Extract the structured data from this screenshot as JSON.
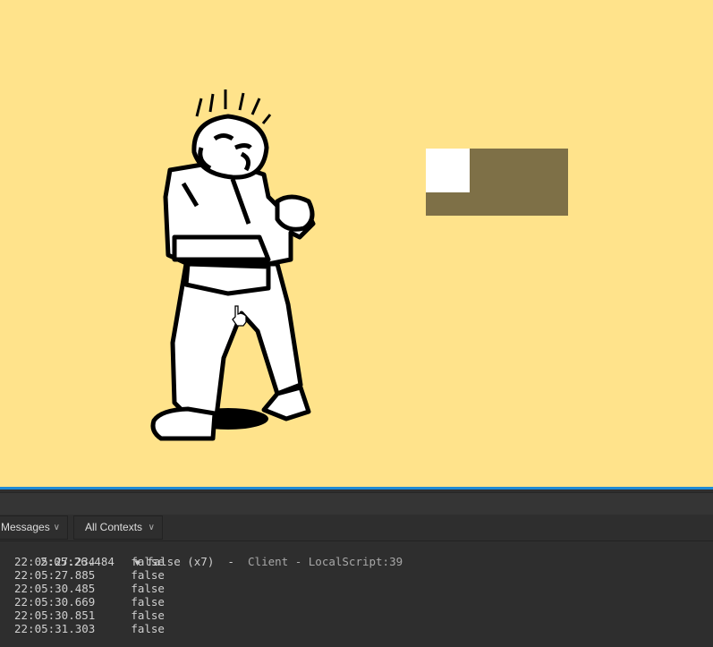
{
  "viewport": {
    "background": "#ffe38b",
    "progress_bar_fill": 0.31
  },
  "output": {
    "filters": [
      {
        "label": "Messages"
      },
      {
        "label": "All Contexts"
      }
    ],
    "group": {
      "timestamp": "2:05:26.484",
      "arrow": "▼",
      "message": "false (x7)",
      "sep1": "-",
      "context": "Client",
      "sep2": "-",
      "source": "LocalScript:39"
    },
    "entries": [
      {
        "timestamp": "22:05:27.234",
        "message": "false"
      },
      {
        "timestamp": "22:05:27.885",
        "message": "false"
      },
      {
        "timestamp": "22:05:30.485",
        "message": "false"
      },
      {
        "timestamp": "22:05:30.669",
        "message": "false"
      },
      {
        "timestamp": "22:05:30.851",
        "message": "false"
      },
      {
        "timestamp": "22:05:31.303",
        "message": "false"
      }
    ]
  }
}
